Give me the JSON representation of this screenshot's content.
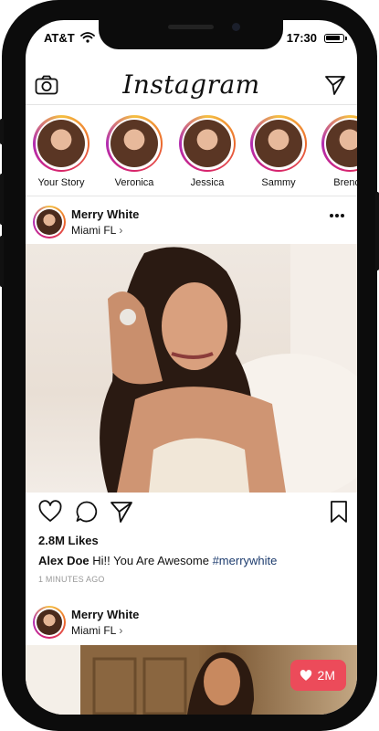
{
  "status_bar": {
    "carrier": "AT&T",
    "time": "17:30"
  },
  "header": {
    "logo": "Instagram",
    "icons": [
      "camera-icon",
      "send-icon"
    ]
  },
  "stories": [
    {
      "name": "Your Story"
    },
    {
      "name": "Veronica"
    },
    {
      "name": "Jessica"
    },
    {
      "name": "Sammy"
    },
    {
      "name": "Brenda"
    }
  ],
  "posts": [
    {
      "user": "Merry White",
      "location": "Miami FL",
      "location_chevron": "›",
      "likes": "2.8M Likes",
      "comment_user": "Alex Doe",
      "comment_text": "Hi!! You Are Awesome",
      "hashtag": "#merrywhite",
      "time_ago": "1 MINUTES AGO"
    },
    {
      "user": "Merry White",
      "location": "Miami FL",
      "location_chevron": "›",
      "like_badge": "2M"
    }
  ],
  "colors": {
    "accent_badge": "#ec4b5a",
    "hashtag": "#1d3c6e",
    "story_ring": [
      "#f5c042",
      "#ec6b2d",
      "#d8246b",
      "#b22db2"
    ]
  }
}
